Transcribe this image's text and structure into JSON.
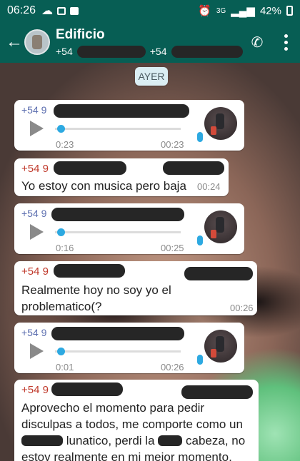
{
  "status_bar": {
    "time": "06:26",
    "network_label": "3G",
    "battery": "42%"
  },
  "header": {
    "title": "Edificio",
    "member_prefix_1": "+54",
    "member_prefix_2": "+54"
  },
  "chat": {
    "day_label": "AYER",
    "messages": [
      {
        "type": "voice",
        "sender": "+54 9",
        "elapsed": "0:23",
        "time": "00:23"
      },
      {
        "type": "text",
        "sender": "+54 9",
        "text": "Yo estoy con musica pero baja",
        "time": "00:24"
      },
      {
        "type": "voice",
        "sender": "+54 9",
        "elapsed": "0:16",
        "time": "00:25"
      },
      {
        "type": "text",
        "sender": "+54 9",
        "text_line1": "Realmente hoy no soy yo el",
        "text_line2": "problematico(?",
        "time": "00:26"
      },
      {
        "type": "voice",
        "sender": "+54 9",
        "elapsed": "0:01",
        "time": "00:26"
      },
      {
        "type": "text",
        "sender": "+54 9",
        "line1": "Aprovecho el momento para pedir",
        "line2": "disculpas a todos, me comporte como un",
        "line3a": "lunatico, perdi la",
        "line3b": "cabeza, no",
        "line4": "estoy realmente en mi mejor momento,"
      }
    ]
  },
  "colors": {
    "header_bg": "#075e54",
    "accent_blue": "#2da9e1",
    "sender_red": "#c0392b",
    "sender_blue": "#5d6fb0"
  }
}
